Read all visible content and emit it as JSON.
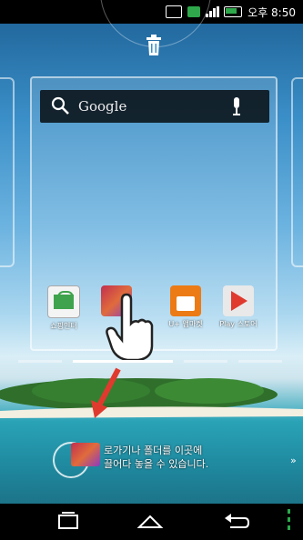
{
  "status_bar": {
    "time": "오후 8:50",
    "icons": [
      "image-icon",
      "usb-icon",
      "signal-icon",
      "battery-icon"
    ]
  },
  "top": {
    "trash_icon": "trash-icon"
  },
  "search_widget": {
    "label": "Google",
    "icons": [
      "search-icon",
      "mic-icon"
    ]
  },
  "apps": [
    {
      "name": "app-shop",
      "label": "쇼핑인터",
      "icon": "shop-icon",
      "color": "#3fa34d"
    },
    {
      "name": "app-hd",
      "label": "",
      "icon": "hd-tv-icon",
      "color": "#c12f4f"
    },
    {
      "name": "app-uplus",
      "label": "U+ 앱마켓",
      "icon": "uplus-market-icon",
      "color": "#ec7b16"
    },
    {
      "name": "app-play-store",
      "label": "Play 스토어",
      "icon": "play-store-icon",
      "color": "#e9e9e9"
    }
  ],
  "drop_zone": {
    "text_line1": "로가기나 폴더를 이곳에",
    "text_line2": "끌어다 놓을 수 있습니다."
  },
  "nav": {
    "icons": [
      "recent-apps-icon",
      "home-icon",
      "back-icon",
      "menu-dots-icon"
    ]
  },
  "colors": {
    "accent_green": "#2aa84b",
    "arrow_red": "#e03a2e"
  }
}
